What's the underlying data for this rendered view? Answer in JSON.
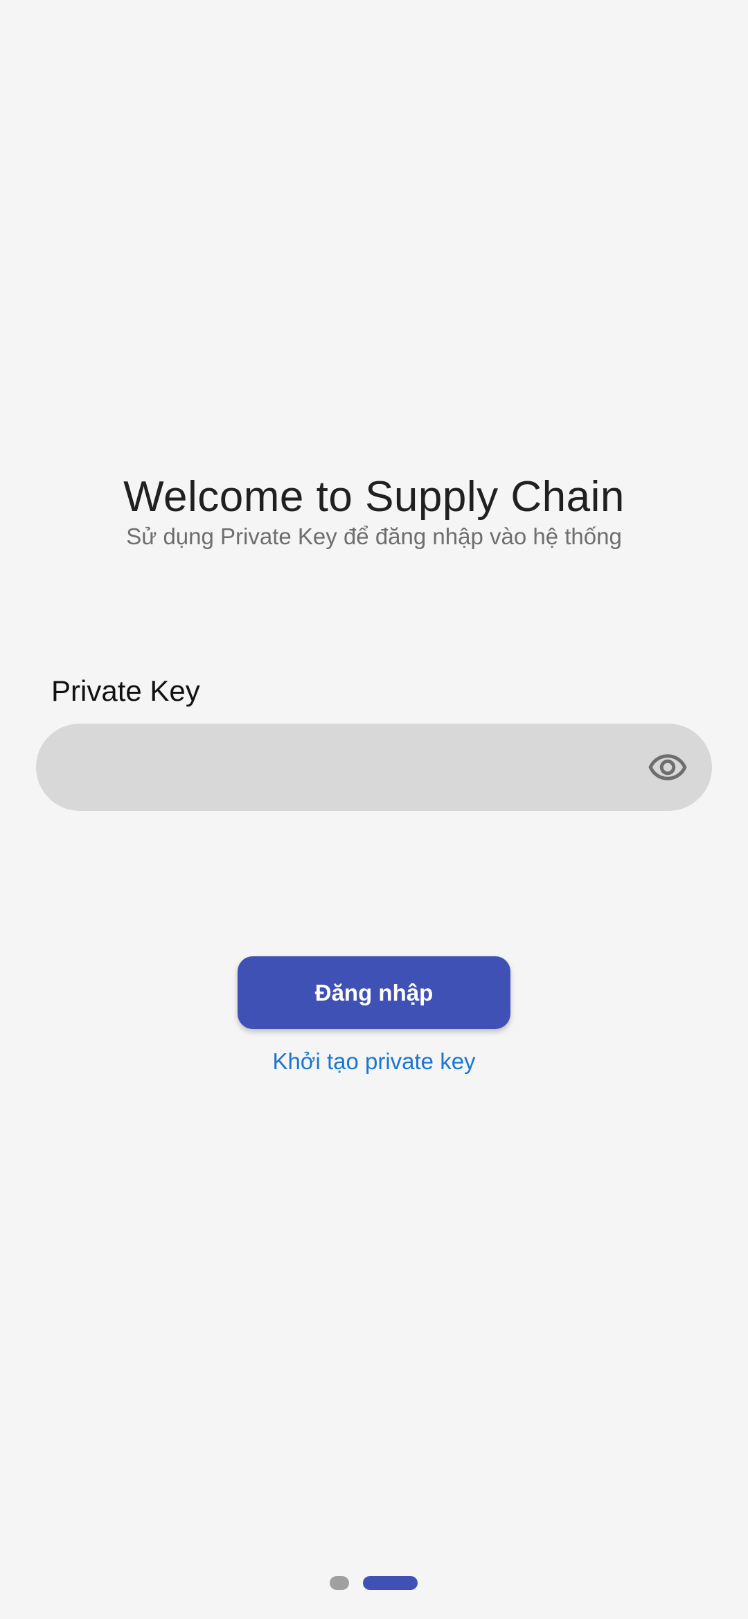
{
  "header": {
    "title": "Welcome to Supply Chain",
    "subtitle": "Sử dụng Private Key để đăng nhập vào hệ thống"
  },
  "form": {
    "private_key_label": "Private Key",
    "private_key_value": "",
    "visibility_icon": "eye-icon"
  },
  "actions": {
    "login_label": "Đăng nhập",
    "create_key_label": "Khởi tạo private key"
  },
  "pager": {
    "page_count": 2,
    "active_page": 2
  },
  "colors": {
    "background": "#f5f5f5",
    "primary": "#3f51b5",
    "link": "#1976d2",
    "field_bg": "#d8d8d8",
    "icon": "#6e6e6e"
  }
}
